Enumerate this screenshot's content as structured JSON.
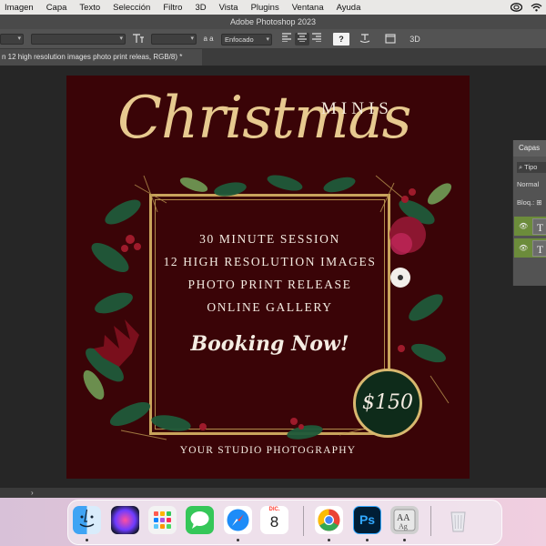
{
  "menubar": {
    "items": [
      "Imagen",
      "Capa",
      "Texto",
      "Selección",
      "Filtro",
      "3D",
      "Vista",
      "Plugins",
      "Ventana",
      "Ayuda"
    ]
  },
  "app_title": "Adobe Photoshop 2023",
  "options_bar": {
    "antialias_label": "a a",
    "antialias_value": "Enfocado",
    "tool_icons": [
      "type-orientation-icon",
      "font-size-icon",
      "align-left-icon",
      "align-center-icon",
      "align-right-icon",
      "text-color-swatch",
      "warp-text-icon",
      "character-panel-icon",
      "3d-icon"
    ],
    "threed_label": "3D"
  },
  "document_tab": {
    "title": "n  12 high resolution images photo print releas, RGB/8) *"
  },
  "design": {
    "minis": "MINIS",
    "title": "Christmas",
    "lines": [
      "30 MINUTE SESSION",
      "12 HIGH RESOLUTION IMAGES",
      "PHOTO PRINT RELEASE",
      "ONLINE GALLERY"
    ],
    "cta": "Booking Now!",
    "price": "$150",
    "studio": "YOUR STUDIO PHOTOGRAPHY",
    "colors": {
      "background": "#3a0407",
      "gold": "#c9a45c",
      "badge": "#0e2b1a"
    }
  },
  "layers_panel": {
    "tab": "Capas",
    "filter": "Tipo",
    "blend_mode": "Normal",
    "lock_label": "Bloq.:",
    "layers": [
      {
        "thumb": "T",
        "visible": true
      },
      {
        "thumb": "T",
        "visible": true
      }
    ]
  },
  "statusbar": {
    "arrow": "›"
  },
  "dock": {
    "apps": [
      "Finder",
      "Siri",
      "Launchpad",
      "Messages",
      "Safari",
      "Calendar",
      "Chrome",
      "Photoshop",
      "Font Book",
      "Trash"
    ],
    "calendar_month": "DIC.",
    "calendar_day": "8",
    "photoshop_label": "Ps"
  }
}
